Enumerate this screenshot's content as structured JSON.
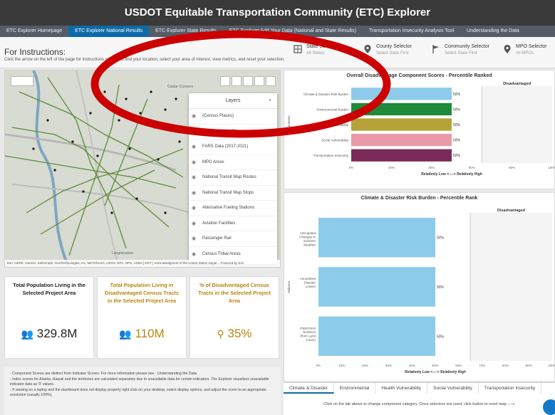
{
  "app": {
    "title": "USDOT Equitable Transportation Community (ETC) Explorer"
  },
  "nav": {
    "tabs": [
      {
        "label": "ETC Explorer  Homepage",
        "active": false
      },
      {
        "label": "ETC Explorer  National Results",
        "active": true
      },
      {
        "label": "ETC Explorer  State Results",
        "active": false
      },
      {
        "label": "ETC Explorer  Add Your Data (National and State Results)",
        "active": false
      },
      {
        "label": "Transportation Insecurity Analysis Tool",
        "active": false
      },
      {
        "label": "Understanding the Data",
        "active": false
      }
    ]
  },
  "header": {
    "title": "For Instructions:",
    "subtitle": "Click the arrow on the left of the page for instructions on how to find your location, select your area of interest, view metrics, and reset your selection.",
    "selectors": [
      {
        "label": "State Selector",
        "value": "All States",
        "icon": "grid-icon"
      },
      {
        "label": "County Selector",
        "value": "Select State First",
        "icon": "map-pin-icon"
      },
      {
        "label": "Community Selector",
        "value": "Select State First",
        "icon": "flag-icon"
      },
      {
        "label": "MPO Selector",
        "value": "All MPOs",
        "icon": "map-pin-icon"
      }
    ]
  },
  "map": {
    "place_label": "Cedar Corners",
    "attribution": "Esri, HERE, Garmin, SafeGraph, GeoTechnologies, Inc, METI/NASA, USGS, EPA, NPS, USDA | DOT | Acknowledgment of the United States Depar...   Powered by Esri",
    "town_label": "Longmeadow",
    "layers_panel": {
      "title": "Layers",
      "close": "×",
      "items": [
        "(Census Places)",
        "Census 2020 UZAs",
        "FARS Data (2017-2021)",
        "MPO Areas",
        "National Transit Map Routes",
        "National Transit Map Stops",
        "Alternative Fueling Stations",
        "Aviation Facilities",
        "Passenger Rail",
        "Census Tribal Areas"
      ]
    }
  },
  "kpis": [
    {
      "title": "Total Population Living in the Selected Project Area",
      "value": "329.8M",
      "color": "#222222",
      "icon": "people-icon"
    },
    {
      "title": "Total Population Living in Disadvantaged Census Tracts in the Selected Project Area",
      "value": "110M",
      "color": "#b8860b",
      "icon": "people-icon"
    },
    {
      "title": "% of Disadvantaged Census Tracts in the Selected Project Area",
      "value": "35%",
      "color": "#b8860b",
      "icon": "location-person-icon"
    }
  ],
  "notes": {
    "line1": "- Component Scores are distinct from Indicator Scores. For more information please see - Understanding the Data.",
    "line2": "- Index scores for Alaska, Hawaii and the territories are calculated separately due to unavailable data for certain indicators. The Explorer visualizes unavailable indicator data as '0' values.",
    "line3": "- If viewing on a laptop and the dashboard does not display properly  right click on your desktop, select display options, and adjust the zoom to an appropriate resolution (usually 100%)."
  },
  "chart_data": [
    {
      "type": "bar",
      "orientation": "horizontal",
      "title": "Overall Disadvantage Component Scores - Percentile Ranked",
      "ylabel": "Components",
      "xlabel": "Relatively Low <----> Relatively High",
      "threshold_label": "Disadvantaged",
      "threshold": 65,
      "xlim": [
        0,
        100
      ],
      "ticks": [
        "0%",
        "20%",
        "40%",
        "60%",
        "80%",
        "100%"
      ],
      "categories": [
        "Climate & Disaster Risk Burden",
        "Environmental Burden",
        "Health Vulnerability",
        "Social Vulnerability",
        "Transportation Insecurity"
      ],
      "values": [
        50,
        50,
        50,
        50,
        50
      ],
      "value_labels": [
        "50%",
        "50%",
        "50%",
        "50%",
        "50%"
      ],
      "colors": [
        "#8ccbea",
        "#1f8a3a",
        "#b5a33a",
        "#e99aa6",
        "#7b2a57"
      ]
    },
    {
      "type": "bar",
      "orientation": "horizontal",
      "title": "Climate & Disaster Risk Burden - Percentile Rank",
      "ylabel": "Indicator",
      "xlabel": "Relatively Low <----> Relatively High",
      "threshold_label": "Disadvantaged",
      "threshold": 65,
      "xlim": [
        0,
        100
      ],
      "ticks": [
        "0%",
        "10%",
        "20%",
        "30%",
        "40%",
        "50%",
        "60%",
        "70%",
        "80%",
        "90%",
        "100%"
      ],
      "categories": [
        "Anticipated Changes in Extreme Weather",
        "Annualized Disaster Losses",
        "Impervious Surfaces (from Land Cover)"
      ],
      "values": [
        50,
        50,
        50
      ],
      "value_labels": [
        "50%",
        "50%",
        "50%"
      ],
      "colors": [
        "#8ccbea",
        "#8ccbea",
        "#8ccbea"
      ]
    }
  ],
  "bottom_tabs": [
    {
      "label": "Climate & Disaster",
      "active": true
    },
    {
      "label": "Environmental",
      "active": false
    },
    {
      "label": "Health Vulnerability",
      "active": false
    },
    {
      "label": "Social Vulnerability",
      "active": false
    },
    {
      "label": "Transportation Insecurity",
      "active": false
    }
  ],
  "reset_note": "Click on the tab above to change component category. Once selectors are used, click button to reset map ---->",
  "overlay": {
    "color": "#cc0000"
  }
}
